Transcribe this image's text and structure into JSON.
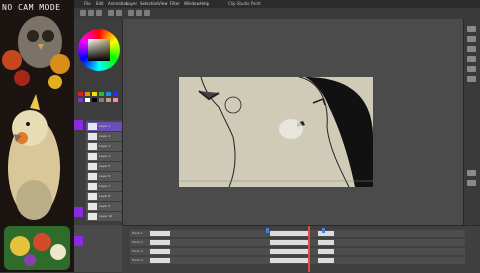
{
  "overlay": {
    "label": "NO CAM MODE"
  },
  "menubar": {
    "items": [
      "File",
      "Edit",
      "Animation",
      "Layer",
      "Selection",
      "View",
      "Filter",
      "Window",
      "Help"
    ],
    "title": "Clip Studio Paint"
  },
  "colors": {
    "background": "#3b3b3b",
    "canvas_paper": "#cfcbb7",
    "accent_purple": "#8a2be2",
    "playhead": "#e44848",
    "accent_blue": "#4a7fd8"
  },
  "palette": {
    "swatches": [
      "#d62020",
      "#f08c00",
      "#f2e200",
      "#2dbd2d",
      "#1c8de0",
      "#2a2aff",
      "#8a2be2",
      "#ffffff",
      "#000000",
      "#808080",
      "#c0a080",
      "#ff7fbf"
    ]
  },
  "layers": {
    "rows": [
      "Layer 1",
      "Layer 2",
      "Layer 3",
      "Layer 4",
      "Layer 5",
      "Layer 6",
      "Layer 7",
      "Layer 8",
      "Layer 9",
      "Layer 10"
    ]
  },
  "timeline": {
    "tracks": [
      "Track 1",
      "Track 2",
      "Track 3",
      "Track 4"
    ]
  }
}
